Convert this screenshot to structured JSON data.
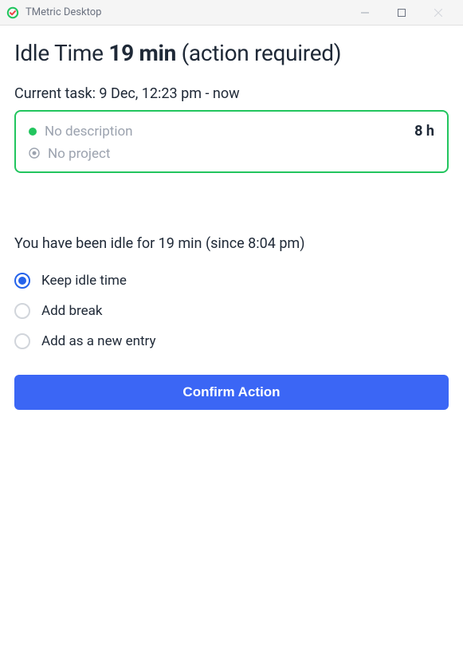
{
  "window": {
    "title": "TMetric Desktop"
  },
  "heading": {
    "prefix": "Idle Time ",
    "duration": "19 min",
    "suffix": " (action required)"
  },
  "current_task": {
    "label": "Current task: 9 Dec, 12:23 pm - now",
    "description": "No description",
    "project": "No project",
    "duration": "8 h"
  },
  "idle_message": "You have been idle for 19 min (since 8:04 pm)",
  "options": {
    "keep": "Keep idle time",
    "break": "Add break",
    "new_entry": "Add as a new entry"
  },
  "confirm_button": "Confirm Action"
}
